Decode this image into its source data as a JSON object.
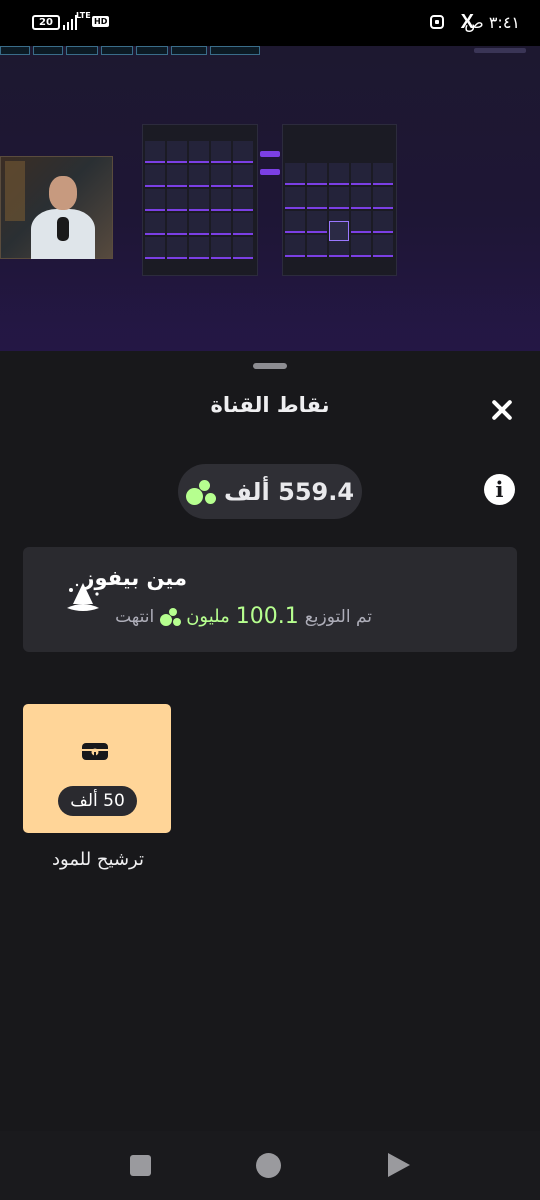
{
  "status_bar": {
    "time": "٣:٤١ ص",
    "battery": "20",
    "network": "LTE",
    "hd_badge": "HD",
    "x_logo": "X"
  },
  "sheet": {
    "title": "نقاط القناة",
    "balance": "559.4 ألف"
  },
  "prediction": {
    "title": "مين بيفوز",
    "distributed_label": "تم التوزيع",
    "amount": "100.1",
    "unit": "مليون",
    "ended_label": "انتهت"
  },
  "reward": {
    "cost": "50 ألف",
    "label": "ترشيح للمود",
    "tile_color": "#ffd598"
  },
  "colors": {
    "accent_points": "#b6ff8f",
    "sheet_background": "#18181b",
    "card_background": "#2a2a2f",
    "stream_purple": "#7b3fe4"
  },
  "icons": {
    "close": "close-icon",
    "info": "info-icon",
    "points": "channel-points-icon",
    "prediction": "wizard-hat-icon",
    "reward": "treasure-chest-icon"
  }
}
